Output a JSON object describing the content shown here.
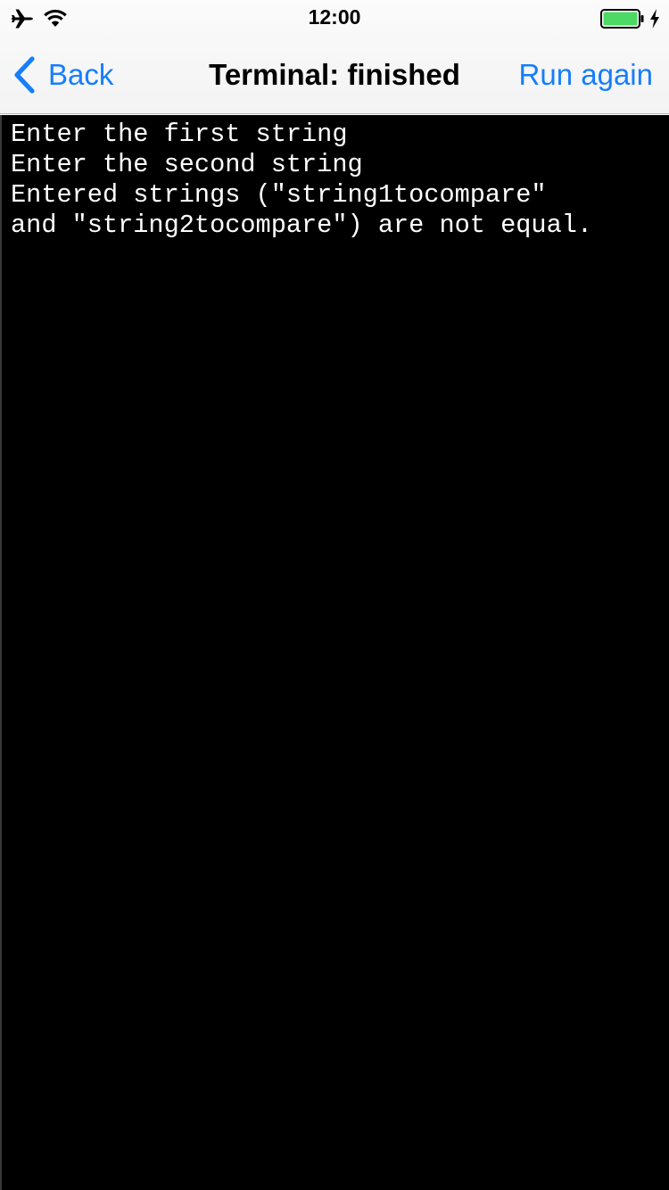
{
  "status_bar": {
    "time": "12:00",
    "icons": [
      "airplane-icon",
      "wifi-icon",
      "battery-icon",
      "charging-icon"
    ],
    "battery_level": 1.0,
    "battery_color": "#4cd964"
  },
  "nav_bar": {
    "back_label": "Back",
    "title": "Terminal: finished",
    "run_again_label": "Run again",
    "accent_color": "#167efb"
  },
  "terminal": {
    "lines": [
      "Enter the first string",
      "Enter the second string",
      "Entered strings (\"string1tocompare\"",
      "and \"string2tocompare\") are not equal."
    ]
  }
}
